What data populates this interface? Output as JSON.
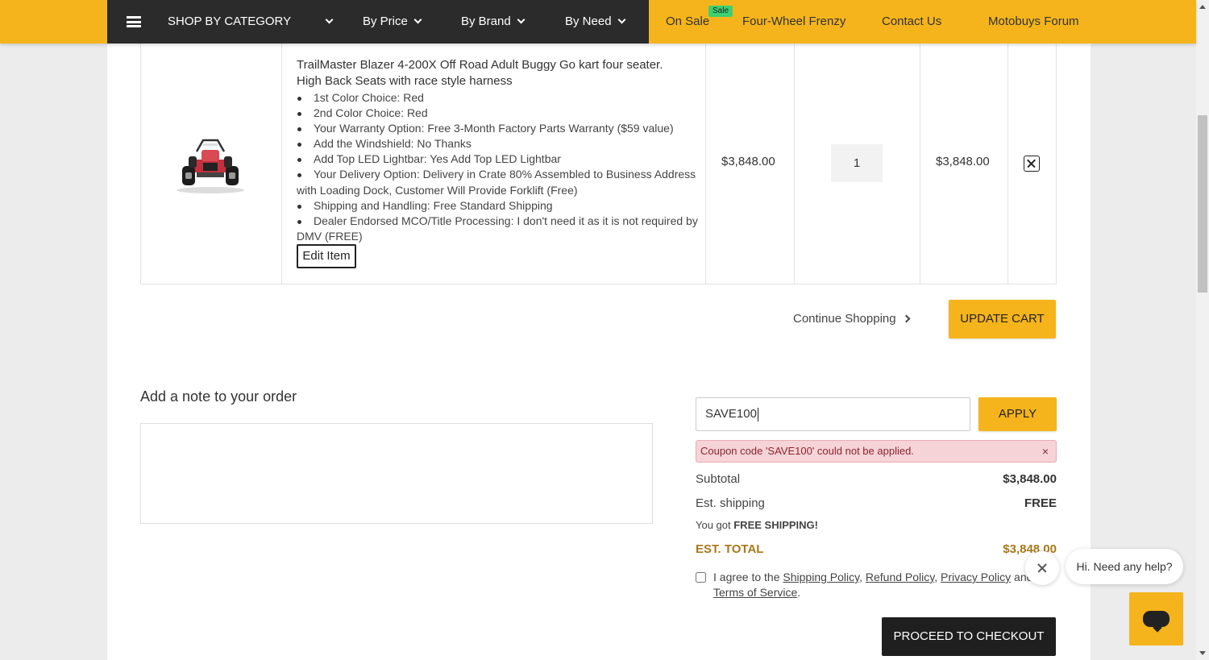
{
  "nav": {
    "shop_by_category": "SHOP BY CATEGORY",
    "by_price": "By Price",
    "by_brand": "By Brand",
    "by_need": "By Need",
    "on_sale": "On Sale",
    "sale_badge": "Sale",
    "four_wheel": "Four-Wheel Frenzy",
    "contact": "Contact Us",
    "forum": "Motobuys Forum"
  },
  "cart": {
    "item": {
      "title": "TrailMaster Blazer 4-200X Off Road Adult Buggy Go kart four seater. High Back Seats with race style harness",
      "options": [
        "1st Color Choice: Red",
        "2nd Color Choice: Red",
        "Your Warranty Option: Free 3-Month Factory Parts Warranty ($59 value)",
        "Add the Windshield: No Thanks",
        "Add Top LED Lightbar: Yes Add Top LED Lightbar",
        "Your Delivery Option: Delivery in Crate 80% Assembled to Business Address with Loading Dock, Customer Will Provide Forklift (Free)",
        "Shipping and Handling: Free Standard Shipping",
        "Dealer Endorsed MCO/Title Processing: I don't need it as it is not required by DMV (FREE)"
      ],
      "edit_label": "Edit Item",
      "price": "$3,848.00",
      "quantity": "1",
      "line_total": "$3,848.00"
    },
    "continue_label": "Continue Shopping",
    "update_label": "UPDATE CART"
  },
  "note": {
    "title": "Add a note to your order"
  },
  "coupon": {
    "value": "SAVE100",
    "apply_label": "APPLY",
    "error": "Coupon code 'SAVE100' could not be applied.",
    "error_close": "×"
  },
  "summary": {
    "subtotal_label": "Subtotal",
    "subtotal": "$3,848.00",
    "shipping_label": "Est. shipping",
    "shipping": "FREE",
    "free_msg_prefix": "You got ",
    "free_msg_bold": "FREE SHIPPING!",
    "total_label": "EST. TOTAL",
    "total": "$3,848.00"
  },
  "agree": {
    "prefix": "I agree to the ",
    "shipping_policy": "Shipping Policy",
    "sep1": ", ",
    "refund_policy": "Refund Policy",
    "sep2": ", ",
    "privacy_policy": "Privacy Policy",
    "and": " and ",
    "terms": "Terms of Service",
    "end": "."
  },
  "checkout_label": "PROCEED TO CHECKOUT",
  "chat": {
    "message": "Hi. Need any help?"
  },
  "colors": {
    "accent": "#f5b41c",
    "nav_dark": "#2b2b2b",
    "error_bg": "#f6d3d7",
    "total": "#a8791a"
  },
  "icons": [
    "menu-icon",
    "chevron-down-icon",
    "close-icon",
    "chevron-right-icon",
    "chat-icon",
    "product-buggy-image"
  ]
}
